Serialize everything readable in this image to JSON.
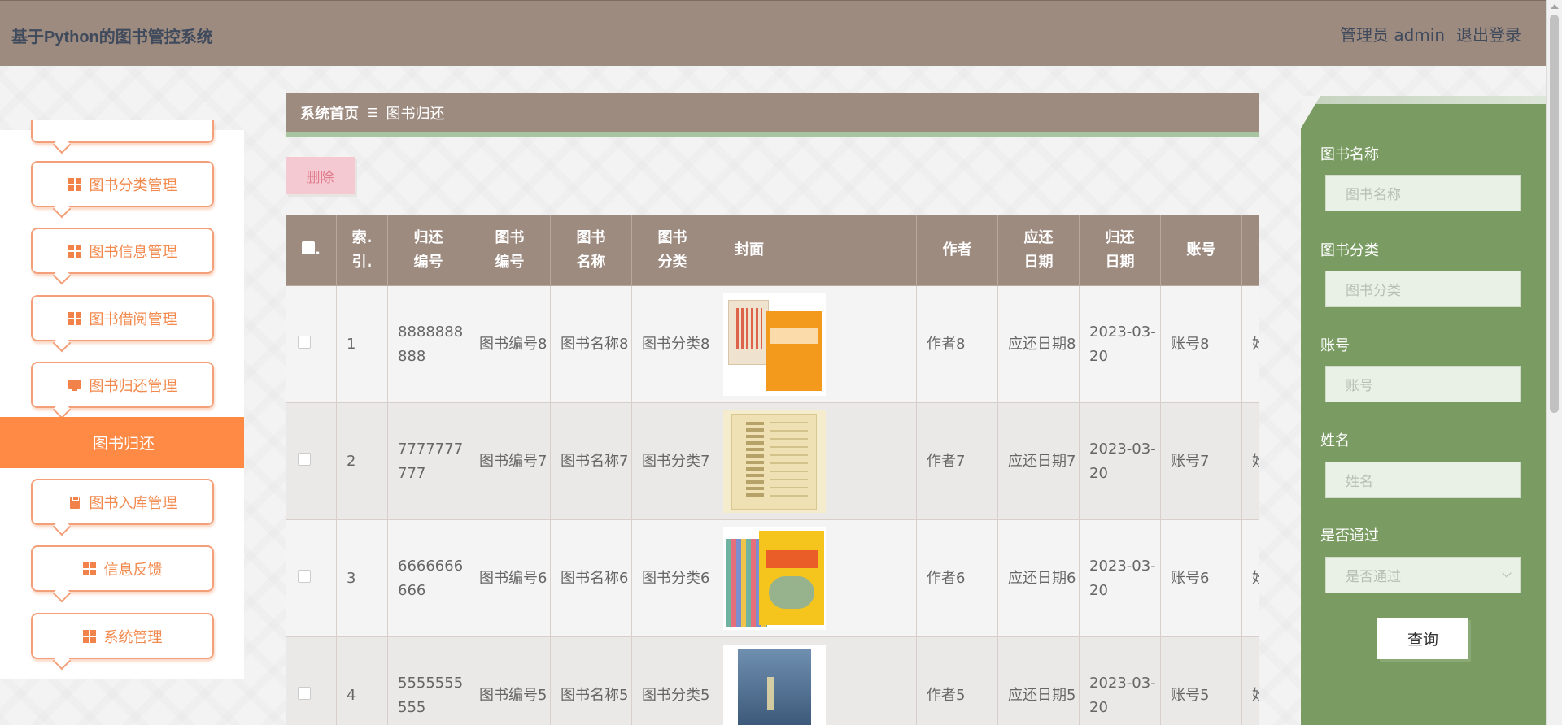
{
  "header": {
    "title": "基于Python的图书管控系统",
    "user_label": "管理员 admin",
    "logout_label": "退出登录"
  },
  "sidebar": {
    "items": [
      {
        "label": "图书分类管理",
        "icon": "grid-icon"
      },
      {
        "label": "图书信息管理",
        "icon": "grid-icon"
      },
      {
        "label": "图书借阅管理",
        "icon": "grid-icon"
      },
      {
        "label": "图书归还管理",
        "icon": "monitor-icon"
      },
      {
        "label": "图书入库管理",
        "icon": "clipboard-icon"
      },
      {
        "label": "信息反馈",
        "icon": "grid-icon"
      },
      {
        "label": "系统管理",
        "icon": "grid-icon"
      }
    ],
    "active_sub": "图书归还"
  },
  "breadcrumb": {
    "home": "系统首页",
    "separator": "☰",
    "current": "图书归还"
  },
  "toolbar": {
    "delete_label": "删除"
  },
  "table": {
    "columns": [
      "索引",
      "归还编号",
      "图书编号",
      "图书名称",
      "图书分类",
      "封面",
      "作者",
      "应还日期",
      "归还日期",
      "账号"
    ],
    "column_display": [
      [
        "索.",
        "引."
      ],
      [
        "归还",
        "编号"
      ],
      [
        "图书",
        "编号"
      ],
      [
        "图书",
        "名称"
      ],
      [
        "图书",
        "分类"
      ],
      [
        "封面"
      ],
      [
        "作者"
      ],
      [
        "应还",
        "日期"
      ],
      [
        "归还",
        "日期"
      ],
      [
        "账号"
      ]
    ],
    "rows": [
      {
        "index": "1",
        "return_no": "8888888888",
        "book_no": "图书编号8",
        "book_name": "图书名称8",
        "book_cat": "图书分类8",
        "author": "作者8",
        "due_date": "应还日期8",
        "return_date": "2023-03-20",
        "account": "账号8",
        "name_partial": "姓"
      },
      {
        "index": "2",
        "return_no": "7777777777",
        "book_no": "图书编号7",
        "book_name": "图书名称7",
        "book_cat": "图书分类7",
        "author": "作者7",
        "due_date": "应还日期7",
        "return_date": "2023-03-20",
        "account": "账号7",
        "name_partial": "姓"
      },
      {
        "index": "3",
        "return_no": "6666666666",
        "book_no": "图书编号6",
        "book_name": "图书名称6",
        "book_cat": "图书分类6",
        "author": "作者6",
        "due_date": "应还日期6",
        "return_date": "2023-03-20",
        "account": "账号6",
        "name_partial": "姓"
      },
      {
        "index": "4",
        "return_no": "5555555555",
        "book_no": "图书编号5",
        "book_name": "图书名称5",
        "book_cat": "图书分类5",
        "author": "作者5",
        "due_date": "应还日期5",
        "return_date": "2023-03-20",
        "account": "账号5",
        "name_partial": "姓"
      }
    ]
  },
  "filter": {
    "book_name_label": "图书名称",
    "book_name_placeholder": "图书名称",
    "book_cat_label": "图书分类",
    "book_cat_placeholder": "图书分类",
    "account_label": "账号",
    "account_placeholder": "账号",
    "name_label": "姓名",
    "name_placeholder": "姓名",
    "approved_label": "是否通过",
    "approved_placeholder": "是否通过",
    "query_label": "查询"
  },
  "colors": {
    "header_bg": "#9e8b80",
    "accent_orange": "#ff8a45",
    "filter_green": "#7a9c63",
    "delete_pink": "#f5c9d2"
  }
}
